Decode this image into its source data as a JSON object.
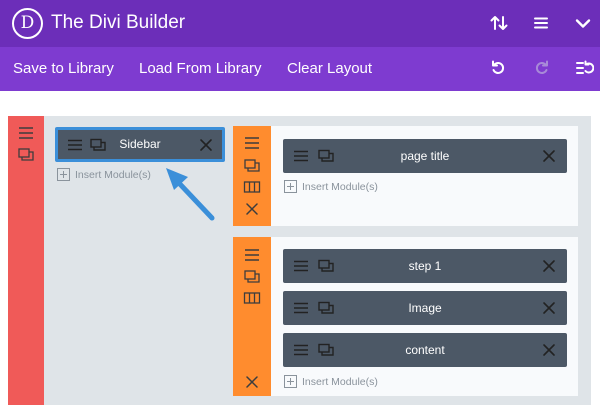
{
  "header": {
    "logo_letter": "D",
    "title": "The Divi Builder",
    "icons": [
      "sort-arrows-icon",
      "hamburger-menu-icon",
      "chevron-down-icon"
    ]
  },
  "toolbar": {
    "save_label": "Save to Library",
    "load_label": "Load From Library",
    "clear_label": "Clear Layout",
    "icons": [
      "undo-icon",
      "redo-icon",
      "history-icon"
    ]
  },
  "colors": {
    "header": "#6c2eb9",
    "toolbar": "#7e3bd0",
    "section": "#f05a58",
    "row": "#ff8c2e",
    "module": "#4c5866",
    "selected_border": "#3b8fd9",
    "canvas": "#dfe4e8"
  },
  "sidebar_column": {
    "module_label": "Sidebar",
    "insert_label": "Insert Module(s)"
  },
  "rows": [
    {
      "modules": [
        {
          "label": "page title"
        }
      ],
      "insert_label": "Insert Module(s)"
    },
    {
      "modules": [
        {
          "label": "step 1"
        },
        {
          "label": "Image"
        },
        {
          "label": "content"
        }
      ],
      "insert_label": "Insert Module(s)"
    }
  ]
}
